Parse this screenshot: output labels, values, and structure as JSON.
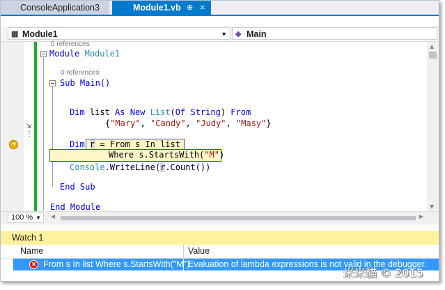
{
  "tabs": [
    {
      "label": "ConsoleApplication3",
      "active": false
    },
    {
      "label": "Module1.vb",
      "active": true,
      "pin": "⊕",
      "close": "×"
    }
  ],
  "nav": {
    "left_combo": "Module1",
    "right_combo": "Main"
  },
  "code": {
    "lens1": "0 references",
    "line_module_kw": "Module",
    "line_module_name": "Module1",
    "lens2": "0 references",
    "line_sub": "Sub Main()",
    "line_dim_kw": "Dim",
    "line_dim_list": " list ",
    "line_as_new": "As New",
    "line_list_type": "List",
    "line_of_string_open": "(",
    "line_of_kw": "Of",
    "line_string_kw": "String",
    "line_of_string_close": ")",
    "line_from_kw": "From",
    "line_init_open": "{",
    "line_init_s1": "\"Mary\"",
    "line_init_s2": "\"Candy\"",
    "line_init_s3": "\"Judy\"",
    "line_init_s4": "\"Masy\"",
    "line_init_sep": ", ",
    "line_init_close": "}",
    "line_dim2_kw": "Dim",
    "line_dim2_var": "r",
    "line_query1": " = From s In list",
    "line_query2": "Where s.StartsWith(",
    "line_query2_str": "\"M\"",
    "line_query2_close": ")",
    "line_console_type": "Console",
    "line_console_rest_a": ".WriteLine(",
    "line_console_var": "r",
    "line_console_rest_b": ".Count())",
    "line_end_sub": "End Sub",
    "line_end_module": "End Module"
  },
  "zoom": "100 %",
  "watch": {
    "title": "Watch 1",
    "col_name": "Name",
    "col_value": "Value",
    "rows": [
      {
        "name": "From s In list Where s.StartsWith(\"M\")",
        "value": "Evaluation of lambda expressions is not valid in the debugger."
      }
    ]
  },
  "watermark": "米米貓 © 2015",
  "colors": {
    "accent": "#007acc",
    "watch_title_bg": "#fff29d",
    "selection": "#3399ff",
    "keyword": "#0000ff",
    "type": "#2b91af",
    "string": "#a31515"
  }
}
